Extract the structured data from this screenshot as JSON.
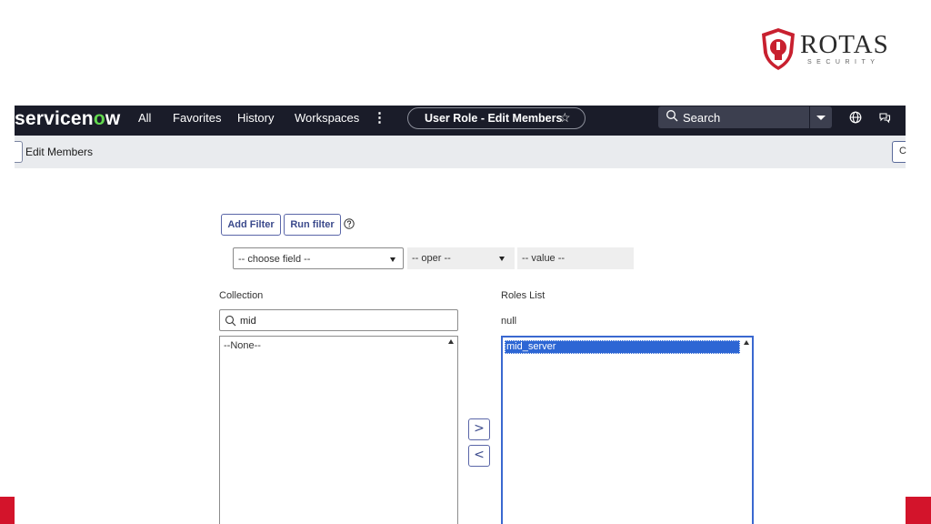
{
  "logo": {
    "brand": "ROTAS",
    "sub": "SECURITY"
  },
  "nav": {
    "brand_pre": "servicen",
    "brand_o": "o",
    "brand_post": "w",
    "items": [
      "All",
      "Favorites",
      "History",
      "Workspaces"
    ],
    "more": "⋮",
    "page_pill": "User Role - Edit Members",
    "star": "☆",
    "search_placeholder": "Search"
  },
  "subheader": {
    "title": "Edit Members",
    "right_char": "C"
  },
  "filter": {
    "add_filter": "Add Filter",
    "run_filter": "Run filter",
    "field": "-- choose field --",
    "oper": "-- oper --",
    "value": "-- value --"
  },
  "collection": {
    "label": "Collection",
    "search_value": "mid",
    "items": [
      "--None--"
    ]
  },
  "roles": {
    "label": "Roles List",
    "query_value": "null",
    "items": [
      "mid_server"
    ]
  },
  "move": {
    "add": ">",
    "remove": "<"
  },
  "colors": {
    "nav_bg": "#1a1c29",
    "brand_o": "#62d84e",
    "selection": "#2d66d4",
    "red_accent": "#d3142b"
  }
}
